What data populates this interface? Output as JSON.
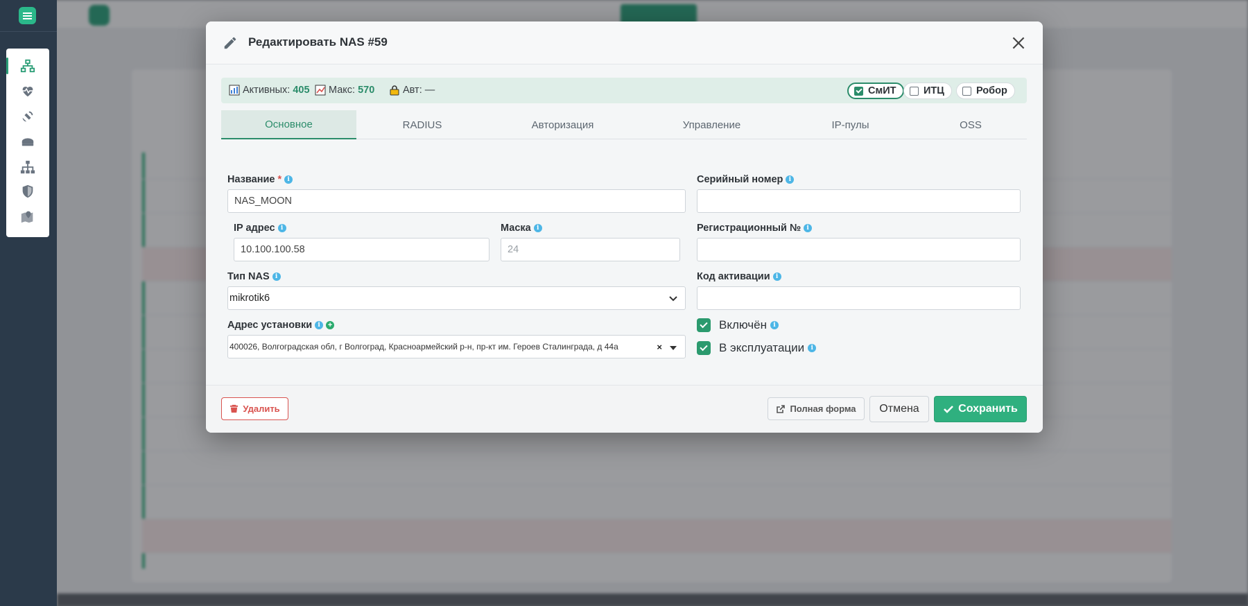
{
  "modal": {
    "title": "Редактировать NAS #59",
    "stats": {
      "active_label": "Активных:",
      "active_value": "405",
      "max_label": "Макс:",
      "max_value": "570",
      "auth_label": "Авт:",
      "auth_value": "—"
    },
    "orgs": [
      {
        "label": "СмИТ",
        "checked": true
      },
      {
        "label": "ИТЦ",
        "checked": false
      },
      {
        "label": "Робор",
        "checked": false
      }
    ],
    "tabs": [
      "Основное",
      "RADIUS",
      "Авторизация",
      "Управление",
      "IP-пулы",
      "OSS"
    ],
    "active_tab": "Основное",
    "fields": {
      "name_label": "Название",
      "name_required": "*",
      "name_value": "NAS_MOON",
      "serial_label": "Серийный номер",
      "serial_value": "",
      "ip_label": "IP адрес",
      "ip_value": "10.100.100.58",
      "mask_label": "Маска",
      "mask_value": "24",
      "reg_label": "Регистрационный №",
      "reg_value": "",
      "type_label": "Тип NAS",
      "type_value": "mikrotik6",
      "activation_label": "Код активации",
      "activation_value": "",
      "address_label": "Адрес установки",
      "address_value": "400026, Волгоградская обл, г Волгоград, Красноармейский р-н, пр-кт им. Героев Сталинграда, д 44а",
      "address_clear": "×",
      "enabled_label": "Включён",
      "enabled_checked": true,
      "in_service_label": "В эксплуатации",
      "in_service_checked": true
    },
    "footer": {
      "delete_label": "Удалить",
      "full_form_label": "Полная форма",
      "cancel_label": "Отмена",
      "save_label": "Сохранить"
    }
  },
  "colors": {
    "accent": "#2b8c6a",
    "save_button": "#2fb07f",
    "danger": "#d9534f",
    "info": "#4db6e6",
    "rail": "#2b3a4a"
  },
  "icons": {
    "rail": [
      "network-icon",
      "heartbeat-icon",
      "satellite-icon",
      "router-icon",
      "sitemap-icon",
      "shield-icon",
      "map-marker-icon"
    ]
  }
}
